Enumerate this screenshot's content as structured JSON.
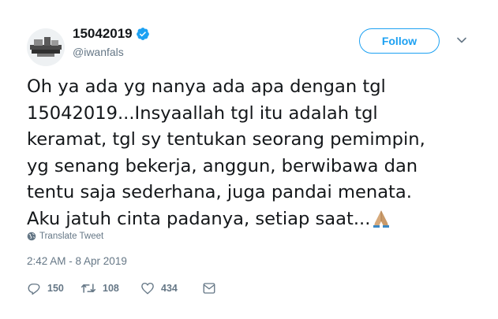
{
  "user": {
    "display_name": "15042019",
    "handle": "@iwanfals",
    "verified": true
  },
  "follow_label": "Follow",
  "tweet": {
    "lines": [
      "Oh ya ada yg nanya ada apa dengan tgl",
      "15042019...Insyaallah tgl itu adalah tgl",
      "keramat, tgl sy tentukan seorang pemimpin,",
      "yg senang bekerja, anggun, berwibawa dan",
      "tentu saja sederhana, juga pandai menata.",
      "Aku jatuh cinta padanya, setiap saat..."
    ],
    "emoji": "folded-hands"
  },
  "translate_label": "Translate Tweet",
  "timestamp": "2:42 AM - 8 Apr 2019",
  "actions": {
    "replies": "150",
    "retweets": "108",
    "likes": "434"
  },
  "colors": {
    "accent": "#1da1f2",
    "secondary_text": "#657786",
    "text": "#14171a"
  },
  "icons": [
    "verified-badge-icon",
    "chevron-down-icon",
    "globe-icon",
    "reply-icon",
    "retweet-icon",
    "like-icon",
    "direct-message-icon"
  ]
}
